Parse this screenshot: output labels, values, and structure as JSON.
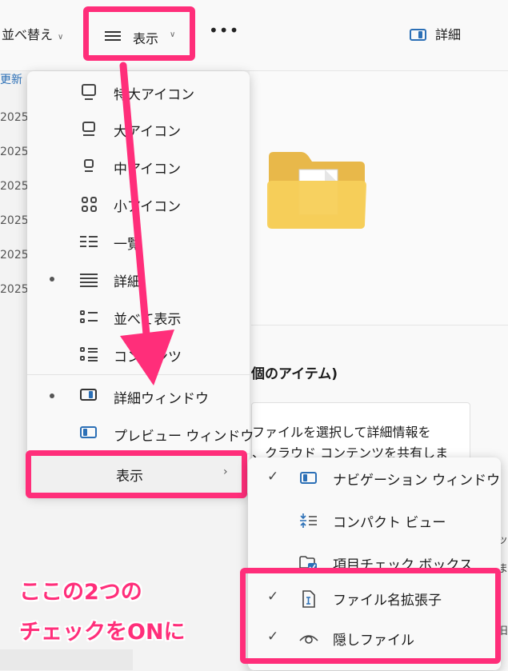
{
  "toolbar": {
    "sort_label": "並べ替え",
    "view_label": "表示",
    "more_label": "•••",
    "details_label": "詳細"
  },
  "background": {
    "column_header": "更新",
    "dates": [
      "2025",
      "2025",
      "2025",
      "2025",
      "2025",
      "2025"
    ],
    "items_title": "個のアイテム)",
    "info_line1": "ファイルを選択して詳細情報を",
    "info_line2": "、クラウド コンテンツを共有しま",
    "edge_texts": [
      "ッ",
      "ま",
      "旧"
    ]
  },
  "menu": {
    "items": [
      {
        "label": "特大アイコン",
        "icon": "extra-large-icons-icon",
        "selected": false
      },
      {
        "label": "大アイコン",
        "icon": "large-icons-icon",
        "selected": false
      },
      {
        "label": "中アイコン",
        "icon": "medium-icons-icon",
        "selected": false
      },
      {
        "label": "小アイコン",
        "icon": "small-icons-icon",
        "selected": false
      },
      {
        "label": "一覧",
        "icon": "list-icon",
        "selected": false
      },
      {
        "label": "詳細",
        "icon": "details-icon",
        "selected": true
      },
      {
        "label": "並べて表示",
        "icon": "tiles-icon",
        "selected": false
      },
      {
        "label": "コンテンツ",
        "icon": "content-icon",
        "selected": false
      },
      {
        "label": "詳細ウィンドウ",
        "icon": "details-pane-icon",
        "selected": true
      },
      {
        "label": "プレビュー ウィンドウ",
        "icon": "preview-pane-icon",
        "selected": false
      }
    ],
    "show_label": "表示",
    "show_arrow": "›"
  },
  "submenu": {
    "items": [
      {
        "label": "ナビゲーション ウィンドウ",
        "checked": true,
        "icon": "navigation-pane-icon"
      },
      {
        "label": "コンパクト ビュー",
        "checked": false,
        "icon": "compact-view-icon"
      },
      {
        "label": "項目チェック ボックス",
        "checked": false,
        "icon": "item-checkbox-icon"
      },
      {
        "label": "ファイル名拡張子",
        "checked": true,
        "icon": "file-extension-icon"
      },
      {
        "label": "隠しファイル",
        "checked": true,
        "icon": "hidden-files-icon"
      }
    ],
    "check_mark": "✓"
  },
  "annotation": {
    "line1": "ここの2つの",
    "line2": "チェックをONに",
    "color": "#ff2e7a"
  }
}
